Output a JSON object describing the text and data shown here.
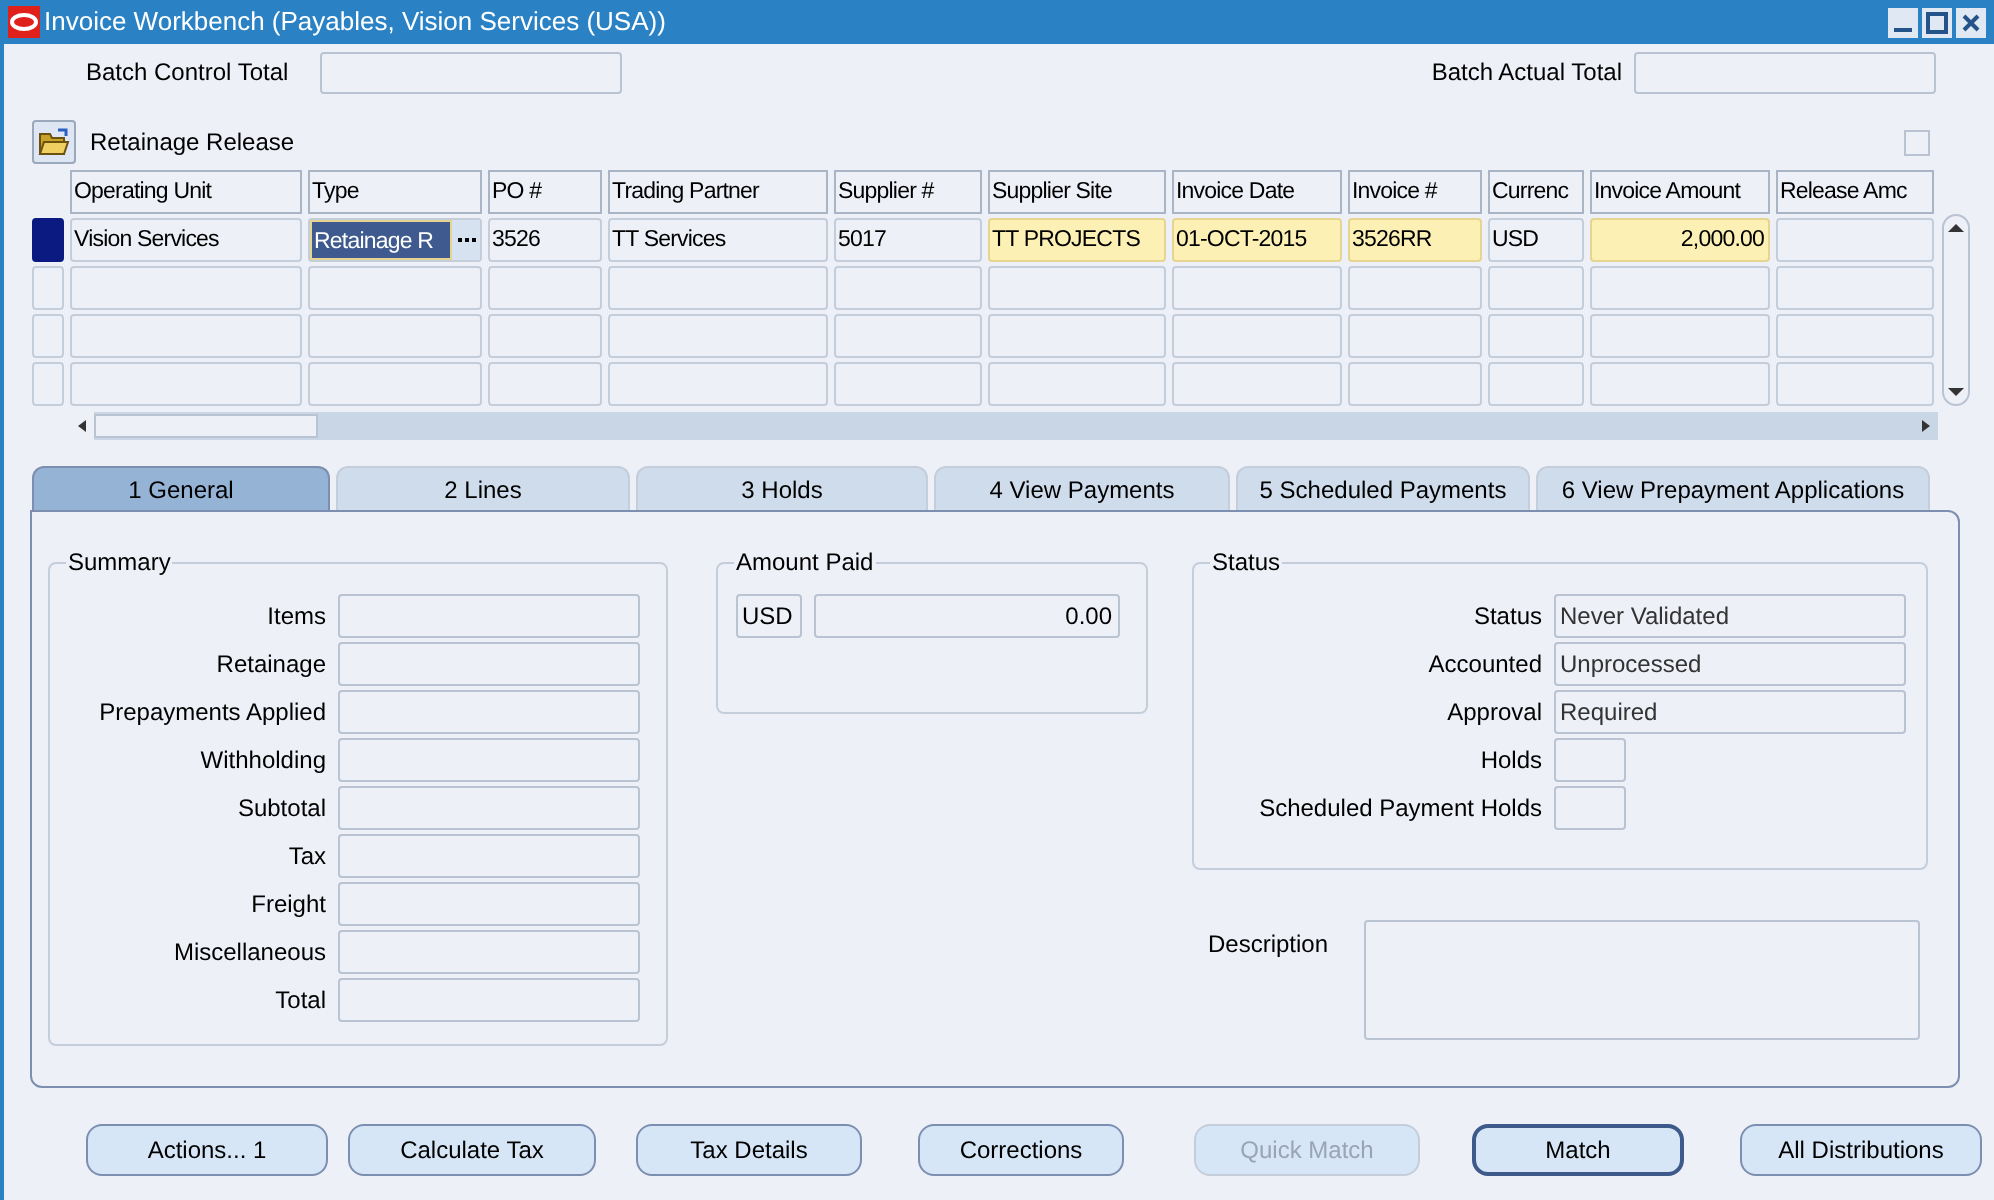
{
  "window": {
    "title": "Invoice Workbench (Payables, Vision Services (USA))"
  },
  "batch_control_total": {
    "label": "Batch Control Total"
  },
  "batch_actual_total": {
    "label": "Batch Actual Total"
  },
  "retainage_release": {
    "label": "Retainage Release",
    "checked": false
  },
  "table": {
    "columns": [
      "Operating Unit",
      "Type",
      "PO #",
      "Trading Partner",
      "Supplier #",
      "Supplier Site",
      "Invoice Date",
      "Invoice #",
      "Currenc",
      "Invoice Amount",
      "Release Amc"
    ],
    "rows": [
      {
        "selected": true,
        "cells": [
          {
            "text": "Vision Services",
            "required": false,
            "focused": false
          },
          {
            "text": "Retainage R",
            "required": false,
            "focused": true
          },
          {
            "text": "3526",
            "required": false,
            "focused": false
          },
          {
            "text": "TT Services",
            "required": false,
            "focused": false
          },
          {
            "text": "5017",
            "required": false,
            "focused": false
          },
          {
            "text": "TT PROJECTS",
            "required": true,
            "focused": false
          },
          {
            "text": "01-OCT-2015",
            "required": true,
            "focused": false
          },
          {
            "text": "3526RR",
            "required": true,
            "focused": false
          },
          {
            "text": "USD",
            "required": false,
            "focused": false
          },
          {
            "text": "2,000.00",
            "required": true,
            "focused": false
          },
          {
            "required": false,
            "focused": false
          }
        ]
      }
    ]
  },
  "tabs": [
    {
      "label": "1 General",
      "selected": true
    },
    {
      "label": "2 Lines",
      "selected": false
    },
    {
      "label": "3 Holds",
      "selected": false
    },
    {
      "label": "4 View Payments",
      "selected": false
    },
    {
      "label": "5 Scheduled Payments",
      "selected": false
    },
    {
      "label": "6 View Prepayment Applications",
      "selected": false
    }
  ],
  "summary": {
    "title": "Summary",
    "fields": [
      {
        "label": "Items"
      },
      {
        "label": "Retainage"
      },
      {
        "label": "Prepayments Applied"
      },
      {
        "label": "Withholding"
      },
      {
        "label": "Subtotal"
      },
      {
        "label": "Tax"
      },
      {
        "label": "Freight"
      },
      {
        "label": "Miscellaneous"
      },
      {
        "label": "Total"
      }
    ]
  },
  "amount_paid": {
    "title": "Amount Paid",
    "currency": "USD",
    "value": "0.00"
  },
  "status": {
    "title": "Status",
    "fields": [
      {
        "label": "Status",
        "value": "Never Validated",
        "kind": "wide"
      },
      {
        "label": "Accounted",
        "value": "Unprocessed",
        "kind": "wide"
      },
      {
        "label": "Approval",
        "value": "Required",
        "kind": "wide"
      },
      {
        "label": "Holds",
        "kind": "small"
      },
      {
        "label": "Scheduled Payment Holds",
        "kind": "small"
      }
    ]
  },
  "description": {
    "label": "Description"
  },
  "buttons": [
    {
      "label": "Actions... 1",
      "disabled": false,
      "default": false
    },
    {
      "label": "Calculate Tax",
      "disabled": false,
      "default": false
    },
    {
      "label": "Tax Details",
      "disabled": false,
      "default": false
    },
    {
      "label": "Corrections",
      "disabled": false,
      "default": false
    },
    {
      "label": "Quick Match",
      "disabled": true,
      "default": false
    },
    {
      "label": "Match",
      "disabled": false,
      "default": true
    },
    {
      "label": "All Distributions",
      "disabled": false,
      "default": false
    }
  ]
}
